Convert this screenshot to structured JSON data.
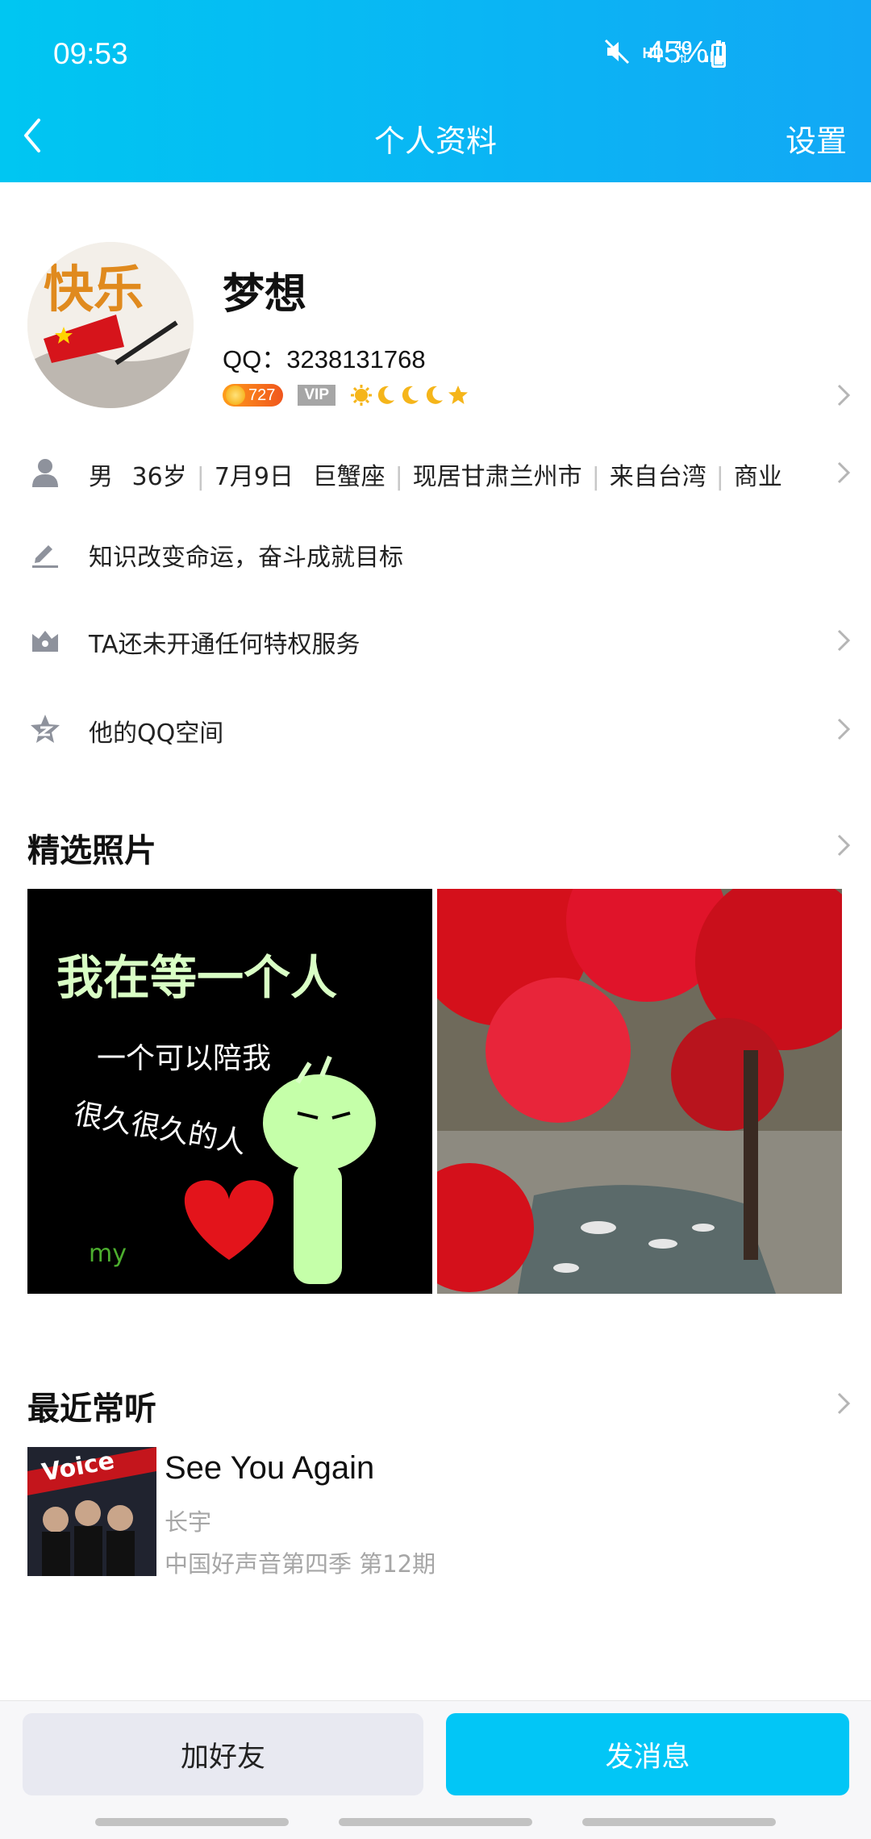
{
  "status_bar": {
    "time": "09:53",
    "network_label": "HD",
    "network_type": "4G",
    "battery": "45%",
    "battery_level": 0.45,
    "icons": [
      "mute-icon",
      "signal-icon",
      "battery-icon"
    ]
  },
  "nav": {
    "back_icon": "chevron-left-icon",
    "title": "个人资料",
    "settings_label": "设置"
  },
  "profile": {
    "avatar_text": "快乐",
    "name": "梦想",
    "qq_label": "QQ：3238131768",
    "level": "727",
    "vip_label": "VIP",
    "rank_icons": [
      "sun-icon",
      "moon-icon",
      "moon-icon",
      "moon-icon",
      "star-icon"
    ]
  },
  "info": {
    "gender": "男",
    "age": "36岁",
    "birthday": "7月9日",
    "zodiac": "巨蟹座",
    "location": "现居甘肃兰州市",
    "hometown": "来自台湾",
    "occupation": "商业",
    "signature": "知识改变命运，奋斗成就目标",
    "privilege": "TA还未开通任何特权服务",
    "qzone": "他的QQ空间"
  },
  "photos": {
    "title": "精选照片",
    "items": [
      {
        "lines": [
          "我在等一个人",
          "一个可以陪我",
          "很久很久的人",
          "my"
        ]
      },
      {
        "description_icon": "landscape-photo"
      }
    ]
  },
  "music": {
    "title": "最近常听",
    "song": "See You Again",
    "artist": "长宇",
    "album": "中国好声音第四季 第12期",
    "cover_text": "Voice"
  },
  "actions": {
    "add_friend": "加好友",
    "send_message": "发消息"
  },
  "colors": {
    "header_start": "#00c6f2",
    "header_end": "#12a8f5",
    "primary_button": "#02c6f6",
    "secondary_button": "#e8e9f1"
  }
}
